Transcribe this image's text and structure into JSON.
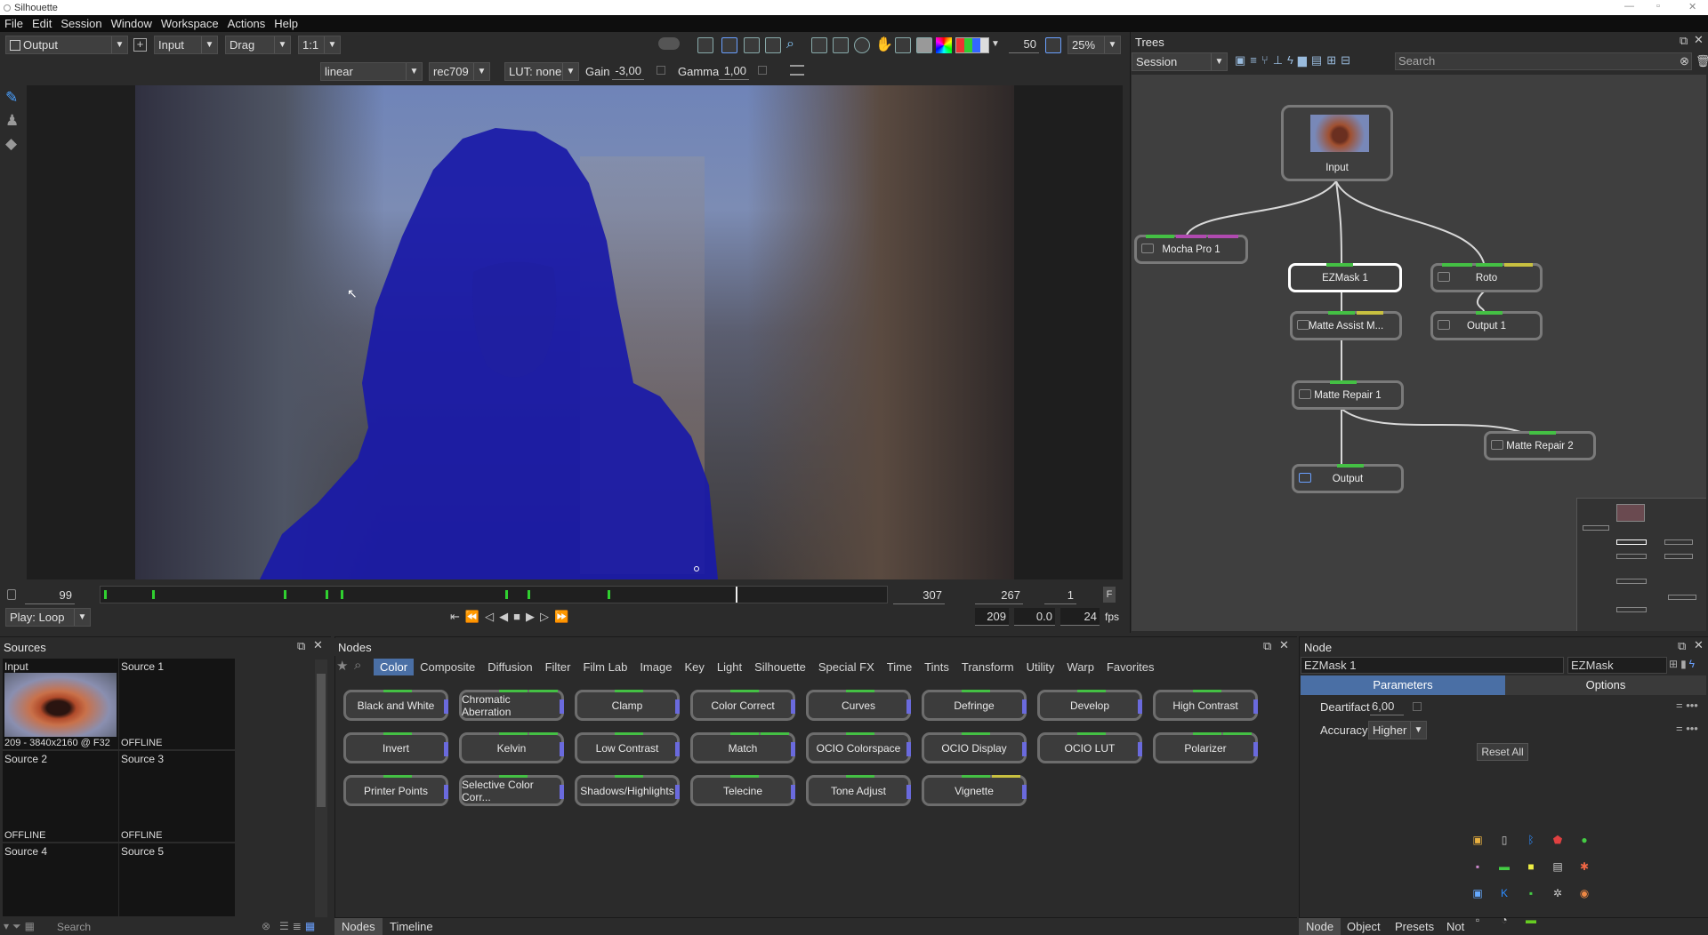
{
  "window": {
    "title": "Silhouette"
  },
  "menu": [
    "File",
    "Edit",
    "Session",
    "Window",
    "Workspace",
    "Actions",
    "Help"
  ],
  "toolbar": {
    "view": "Output",
    "input": "Input",
    "mode": "Drag",
    "ratio": "1:1",
    "frames": "50",
    "zoom": "25%"
  },
  "colorbar": {
    "colorspace": "linear",
    "display": "rec709",
    "lut": "LUT: none",
    "gain_label": "Gain",
    "gain": "-3,00",
    "gamma_label": "Gamma",
    "gamma": "1,00"
  },
  "timeline": {
    "start": "99",
    "end": "307",
    "current": "267",
    "step": "1",
    "play_mode": "Play: Loop",
    "frame": "209",
    "time": "0.0",
    "fps": "24",
    "fps_label": "fps",
    "f_label": "F"
  },
  "sources": {
    "title": "Sources",
    "search_placeholder": "Search",
    "cells": [
      {
        "name": "Input",
        "status": "209 - 3840x2160 @ F32"
      },
      {
        "name": "Source 1",
        "status": "OFFLINE"
      },
      {
        "name": "Source 2",
        "status": "OFFLINE"
      },
      {
        "name": "Source 3",
        "status": "OFFLINE"
      },
      {
        "name": "Source 4",
        "status": ""
      },
      {
        "name": "Source 5",
        "status": ""
      }
    ]
  },
  "nodes_panel": {
    "title": "Nodes",
    "categories": [
      "Color",
      "Composite",
      "Diffusion",
      "Filter",
      "Film Lab",
      "Image",
      "Key",
      "Light",
      "Silhouette",
      "Special FX",
      "Time",
      "Tints",
      "Transform",
      "Utility",
      "Warp",
      "Favorites"
    ],
    "buttons": [
      "Black and White",
      "Chromatic Aberration",
      "Clamp",
      "Color Correct",
      "Curves",
      "Defringe",
      "Develop",
      "High Contrast",
      "Invert",
      "Kelvin",
      "Low Contrast",
      "Match",
      "OCIO Colorspace",
      "OCIO Display",
      "OCIO LUT",
      "Polarizer",
      "Printer Points",
      "Selective Color Corr...",
      "Shadows/Highlights",
      "Telecine",
      "Tone Adjust",
      "Vignette"
    ],
    "tabs": [
      "Nodes",
      "Timeline"
    ]
  },
  "trees": {
    "title": "Trees",
    "session": "Session",
    "search_placeholder": "Search",
    "nodes": {
      "input": "Input",
      "mocha": "Mocha Pro 1",
      "ezmask": "EZMask 1",
      "roto": "Roto",
      "matte_assist": "Matte Assist M...",
      "output1": "Output 1",
      "matte_repair1": "Matte Repair 1",
      "matte_repair2": "Matte Repair 2",
      "output": "Output"
    }
  },
  "node_panel": {
    "title": "Node",
    "name": "EZMask 1",
    "type": "EZMask",
    "tabs": [
      "Parameters",
      "Options"
    ],
    "deartifact_label": "Deartifact",
    "deartifact": "6,00",
    "accuracy_label": "Accuracy",
    "accuracy": "Higher",
    "reset": "Reset All",
    "bottom_tabs": [
      "Node",
      "Object",
      "Presets",
      "Not"
    ]
  },
  "colors": {
    "accent": "#4a6fa5",
    "mask": "#1a1aa8",
    "green": "#44c044",
    "purple": "#b04ab0",
    "yellow": "#c8c040"
  }
}
